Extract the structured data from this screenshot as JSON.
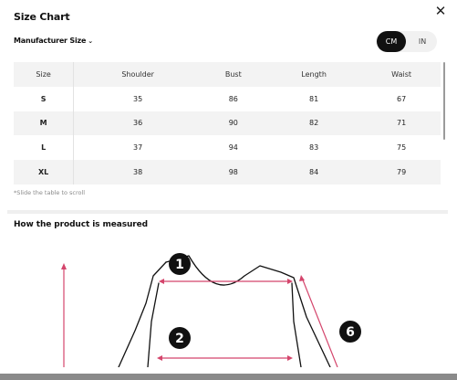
{
  "header": {
    "title": "Size Chart",
    "close_icon": "close-icon"
  },
  "controls": {
    "manufacturer_label": "Manufacturer Size",
    "chevron": "⌄",
    "units": [
      "CM",
      "IN"
    ],
    "selected_unit": "CM"
  },
  "table": {
    "headers": [
      "Size",
      "Shoulder",
      "Bust",
      "Length",
      "Waist"
    ],
    "rows": [
      [
        "S",
        "35",
        "86",
        "81",
        "67"
      ],
      [
        "M",
        "36",
        "90",
        "82",
        "71"
      ],
      [
        "L",
        "37",
        "94",
        "83",
        "75"
      ],
      [
        "XL",
        "38",
        "98",
        "84",
        "79"
      ]
    ]
  },
  "hint": "*Slide the table to scroll",
  "measure": {
    "title": "How the product is measured",
    "markers": [
      "1",
      "2",
      "6"
    ]
  }
}
